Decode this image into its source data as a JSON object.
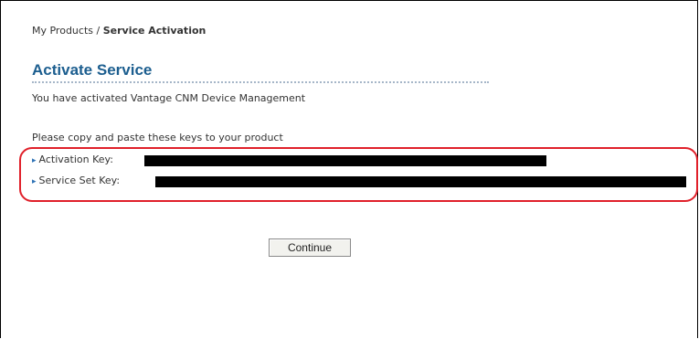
{
  "breadcrumb": {
    "parent": "My Products",
    "separator": "/",
    "current": "Service Activation"
  },
  "page": {
    "title": "Activate Service",
    "message": "You have activated Vantage CNM Device Management",
    "instruction": "Please copy and paste these keys to your product"
  },
  "keys": [
    {
      "label": "Activation Key:",
      "value_redacted": true
    },
    {
      "label": "Service Set Key:",
      "value_redacted": true
    }
  ],
  "actions": {
    "continue_label": "Continue"
  },
  "colors": {
    "title": "#1c5e8f",
    "highlight_border": "#e0202a",
    "bullet": "#2f73b6"
  },
  "icons": {
    "bullet": "arrow-bullet-icon"
  }
}
